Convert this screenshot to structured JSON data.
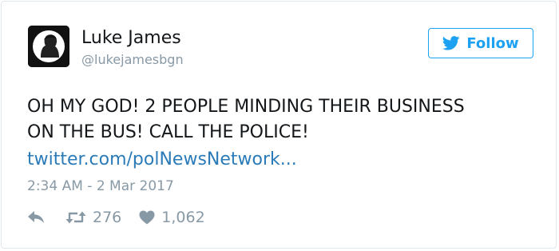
{
  "tweet": {
    "author": {
      "name": "Luke James",
      "handle": "@lukejamesbgn",
      "avatar_icon": "avatar-icon"
    },
    "follow_button": {
      "label": "Follow",
      "icon": "twitter-bird-icon",
      "color": "#1da1f2"
    },
    "text_lines": [
      "OH MY GOD! 2 PEOPLE MINDING THEIR BUSINESS",
      "ON THE BUS! CALL THE POLICE!"
    ],
    "link_text": "twitter.com/polNewsNetwork...",
    "timestamp": "2:34 AM - 2 Mar 2017",
    "actions": {
      "reply_icon": "reply-icon",
      "retweet_icon": "retweet-icon",
      "retweet_count": "276",
      "like_icon": "heart-icon",
      "like_count": "1,062"
    },
    "colors": {
      "link": "#2b7bb9",
      "muted": "#8899a6",
      "text": "#14171a",
      "border": "#e1e8ed"
    }
  }
}
